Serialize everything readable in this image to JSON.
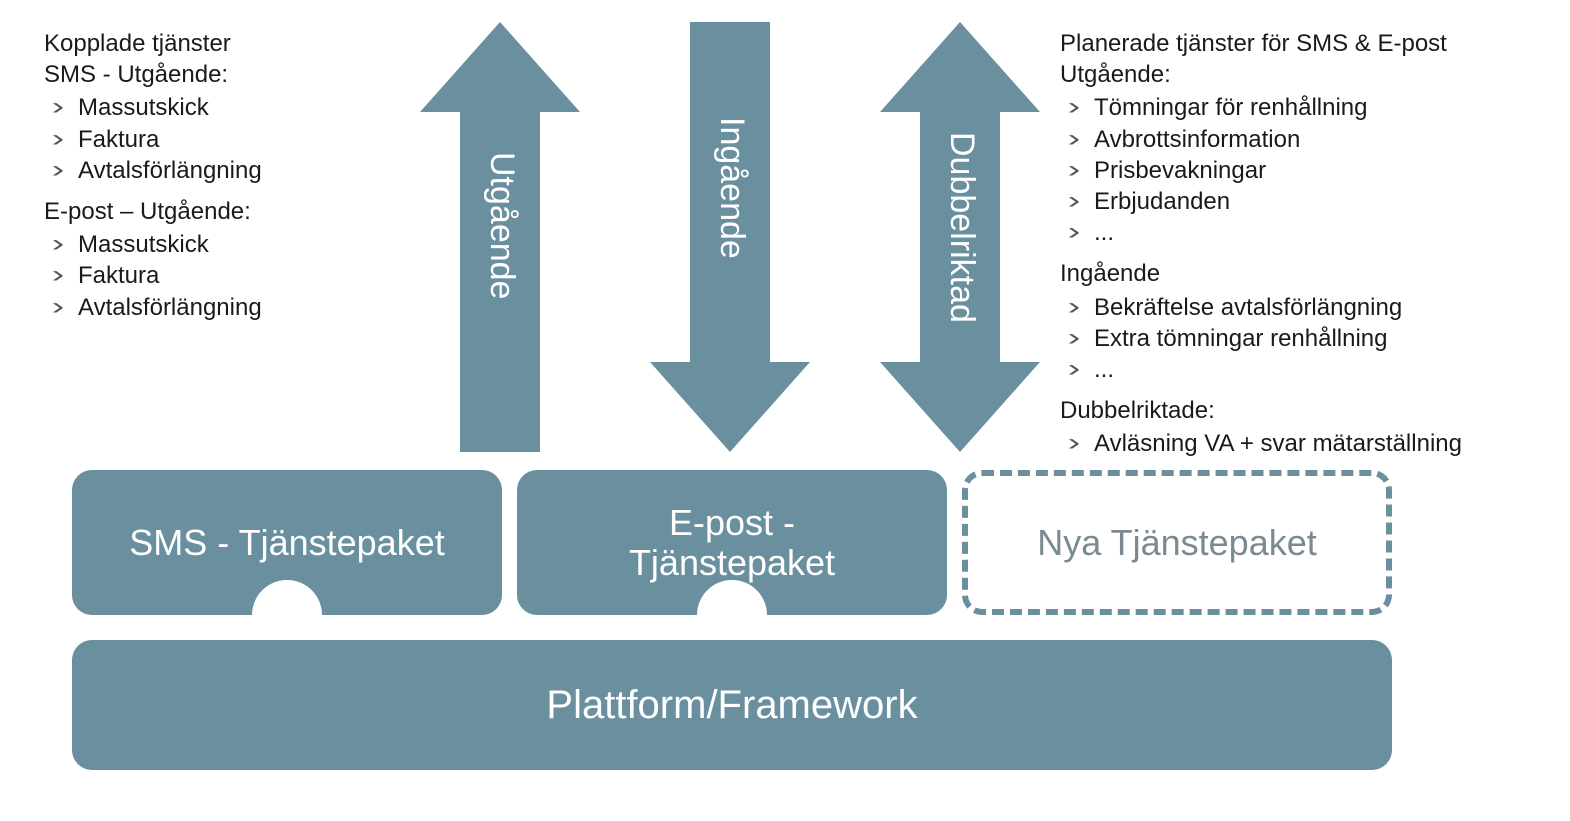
{
  "left_panel": {
    "title": "Kopplade tjänster",
    "section1_title": "SMS - Utgående:",
    "section1_items": [
      "Massutskick",
      "Faktura",
      "Avtalsförlängning"
    ],
    "section2_title": "E-post – Utgående:",
    "section2_items": [
      "Massutskick",
      "Faktura",
      "Avtalsförlängning"
    ]
  },
  "right_panel": {
    "title": "Planerade tjänster för SMS & E-post",
    "section1_title": "Utgående:",
    "section1_items": [
      "Tömningar för renhållning",
      "Avbrottsinformation",
      "Prisbevakningar",
      "Erbjudanden",
      "..."
    ],
    "section2_title": "Ingående",
    "section2_items": [
      "Bekräftelse avtalsförlängning",
      "Extra tömningar renhållning",
      "..."
    ],
    "section3_title": "Dubbelriktade:",
    "section3_items": [
      "Avläsning VA + svar mätarställning",
      "..."
    ]
  },
  "arrows": {
    "up_label": "Utgående",
    "down_label": "Ingående",
    "both_label": "Dubbelriktad"
  },
  "boxes": {
    "sms": "SMS - Tjänstepaket",
    "epost": "E-post -\nTjänstepaket",
    "nya": "Nya Tjänstepaket"
  },
  "platform": "Plattform/Framework",
  "colors": {
    "primary": "#6a8f9e",
    "dashed_text": "#7a8a92"
  }
}
